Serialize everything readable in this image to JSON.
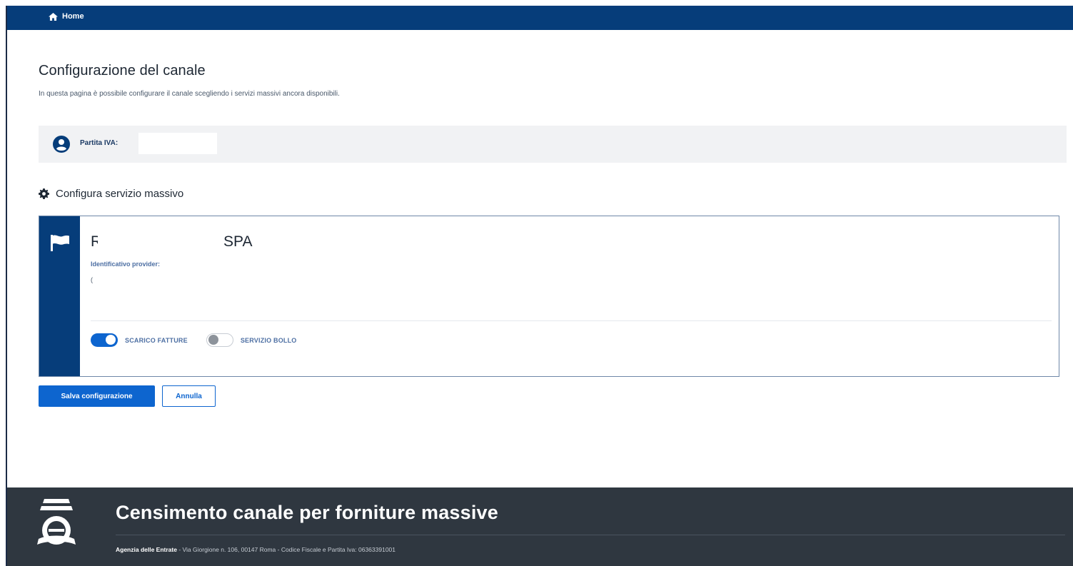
{
  "topbar": {
    "home_label": "Home",
    "color": "#063d7a"
  },
  "page": {
    "title": "Configurazione del canale",
    "subtitle": "In questa pagina è possibile configurare il canale scegliendo i servizi massivi ancora disponibili."
  },
  "piva": {
    "label": "Partita IVA: ",
    "icon": "user-circle-icon"
  },
  "section": {
    "title": "Configura servizio massivo",
    "icon": "gear-icon"
  },
  "provider": {
    "name_prefix": "RI",
    "name_suffix": "SPA",
    "id_label": "Identificativo provider:",
    "id_value": "(",
    "icon": "flag-icon"
  },
  "toggles": [
    {
      "label": "SCARICO FATTURE",
      "state": "on"
    },
    {
      "label": "SERVIZIO BOLLO",
      "state": "off"
    }
  ],
  "actions": {
    "save_label": "Salva configurazione",
    "cancel_label": "Annulla"
  },
  "footer": {
    "title": "Censimento canale per forniture massive",
    "org": "Agenzia delle Entrate",
    "address": " - Via Giorgione n. 106, 00147 Roma - Codice Fiscale e Partita Iva: 06363391001",
    "bg_color": "#2f3740"
  }
}
